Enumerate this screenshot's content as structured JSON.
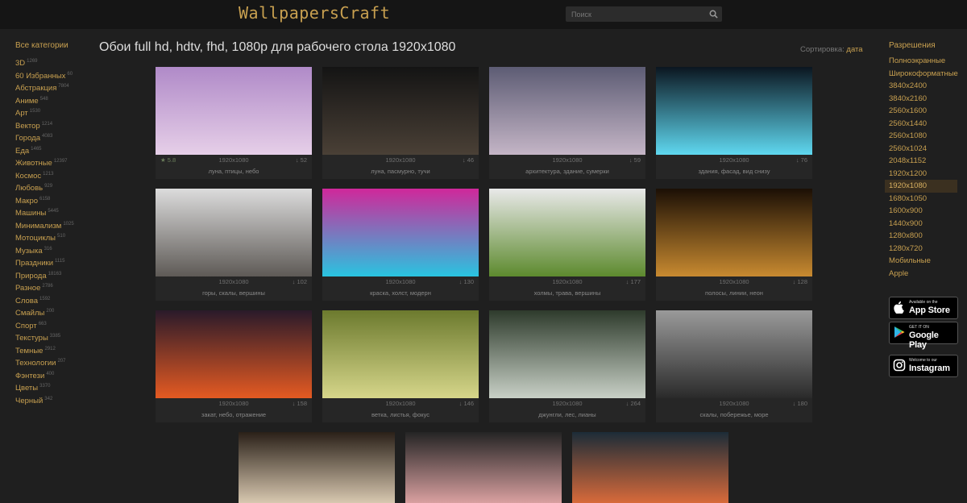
{
  "header": {
    "logo": "WallpapersCraft",
    "search_placeholder": "Поиск"
  },
  "left_nav": {
    "heading": "Все категории",
    "items": [
      {
        "label": "3D",
        "count": "1269"
      },
      {
        "label": "60 Избранных",
        "count": "60"
      },
      {
        "label": "Абстракция",
        "count": "7804"
      },
      {
        "label": "Аниме",
        "count": "548"
      },
      {
        "label": "Арт",
        "count": "1530"
      },
      {
        "label": "Вектор",
        "count": "1214"
      },
      {
        "label": "Города",
        "count": "4083"
      },
      {
        "label": "Еда",
        "count": "1465"
      },
      {
        "label": "Животные",
        "count": "12397"
      },
      {
        "label": "Космос",
        "count": "1213"
      },
      {
        "label": "Любовь",
        "count": "929"
      },
      {
        "label": "Макро",
        "count": "6158"
      },
      {
        "label": "Машины",
        "count": "5445"
      },
      {
        "label": "Минимализм",
        "count": "1025"
      },
      {
        "label": "Мотоциклы",
        "count": "510"
      },
      {
        "label": "Музыка",
        "count": "316"
      },
      {
        "label": "Праздники",
        "count": "1115"
      },
      {
        "label": "Природа",
        "count": "18163"
      },
      {
        "label": "Разное",
        "count": "2786"
      },
      {
        "label": "Слова",
        "count": "1592"
      },
      {
        "label": "Смайлы",
        "count": "200"
      },
      {
        "label": "Спорт",
        "count": "663"
      },
      {
        "label": "Текстуры",
        "count": "3385"
      },
      {
        "label": "Темные",
        "count": "2912"
      },
      {
        "label": "Технологии",
        "count": "207"
      },
      {
        "label": "Фэнтези",
        "count": "400"
      },
      {
        "label": "Цветы",
        "count": "3370"
      },
      {
        "label": "Черный",
        "count": "342"
      }
    ]
  },
  "main": {
    "title": "Обои full hd, hdtv, fhd, 1080p для рабочего стола 1920x1080",
    "sort_label": "Сортировка:",
    "sort_value": "дата",
    "wallpapers": [
      {
        "rating": "5.8",
        "resolution": "1920x1080",
        "downloads": "52",
        "tags": "луна, птицы, небо",
        "palette": [
          "#b08ac8",
          "#e6cfe8"
        ]
      },
      {
        "rating": "",
        "resolution": "1920x1080",
        "downloads": "46",
        "tags": "луна, пасмурно, тучи",
        "palette": [
          "#141414",
          "#4a4036"
        ]
      },
      {
        "rating": "",
        "resolution": "1920x1080",
        "downloads": "59",
        "tags": "архитектура, здание, сумерки",
        "palette": [
          "#5d5c74",
          "#c4b5c6"
        ]
      },
      {
        "rating": "",
        "resolution": "1920x1080",
        "downloads": "76",
        "tags": "здания, фасад, вид снизу",
        "palette": [
          "#0b1620",
          "#5fd8f0"
        ]
      },
      {
        "rating": "",
        "resolution": "1920x1080",
        "downloads": "102",
        "tags": "горы, скалы, вершины",
        "palette": [
          "#dcdcdc",
          "#5e5a56"
        ]
      },
      {
        "rating": "",
        "resolution": "1920x1080",
        "downloads": "130",
        "tags": "краска, холст, модерн",
        "palette": [
          "#d0279a",
          "#29c4e0"
        ]
      },
      {
        "rating": "",
        "resolution": "1920x1080",
        "downloads": "177",
        "tags": "холмы, трава, вершины",
        "palette": [
          "#e9e9e9",
          "#5d8a2e"
        ]
      },
      {
        "rating": "",
        "resolution": "1920x1080",
        "downloads": "128",
        "tags": "полосы, линии, неон",
        "palette": [
          "#1b0f05",
          "#c88a30"
        ]
      },
      {
        "rating": "",
        "resolution": "1920x1080",
        "downloads": "158",
        "tags": "закат, небо, отражение",
        "palette": [
          "#2a1a2a",
          "#e55a22"
        ]
      },
      {
        "rating": "",
        "resolution": "1920x1080",
        "downloads": "146",
        "tags": "ветка, листья, фокус",
        "palette": [
          "#6c7a2e",
          "#d6d68a"
        ]
      },
      {
        "rating": "",
        "resolution": "1920x1080",
        "downloads": "264",
        "tags": "джунгли, лес, лианы",
        "palette": [
          "#2e3b2c",
          "#c8d0c6"
        ]
      },
      {
        "rating": "",
        "resolution": "1920x1080",
        "downloads": "180",
        "tags": "скалы, побережье, море",
        "palette": [
          "#9a9a9a",
          "#2a2a2a"
        ]
      }
    ],
    "partial_wallpapers": [
      {
        "palette": [
          "#2a2018",
          "#d8c8b0"
        ]
      },
      {
        "palette": [
          "#242424",
          "#d9a0a0"
        ]
      },
      {
        "palette": [
          "#1c2c38",
          "#d86a3a"
        ]
      }
    ]
  },
  "right_nav": {
    "heading": "Разрешения",
    "items": [
      {
        "label": "Полноэкранные",
        "active": false
      },
      {
        "label": "Широкоформатные",
        "active": false
      },
      {
        "label": "3840x2400",
        "active": false
      },
      {
        "label": "3840x2160",
        "active": false
      },
      {
        "label": "2560x1600",
        "active": false
      },
      {
        "label": "2560x1440",
        "active": false
      },
      {
        "label": "2560x1080",
        "active": false
      },
      {
        "label": "2560x1024",
        "active": false
      },
      {
        "label": "2048x1152",
        "active": false
      },
      {
        "label": "1920x1200",
        "active": false
      },
      {
        "label": "1920x1080",
        "active": true
      },
      {
        "label": "1680x1050",
        "active": false
      },
      {
        "label": "1600x900",
        "active": false
      },
      {
        "label": "1440x900",
        "active": false
      },
      {
        "label": "1280x800",
        "active": false
      },
      {
        "label": "1280x720",
        "active": false
      },
      {
        "label": "Мобильные",
        "active": false
      },
      {
        "label": "Apple",
        "active": false
      }
    ]
  },
  "stores": [
    {
      "small": "Available on the",
      "big": "App Store",
      "icon": "apple-icon"
    },
    {
      "small": "GET IT ON",
      "big": "Google Play",
      "icon": "google-play-icon"
    },
    {
      "small": "Welcome to our",
      "big": "Instagram",
      "icon": "instagram-icon"
    }
  ]
}
